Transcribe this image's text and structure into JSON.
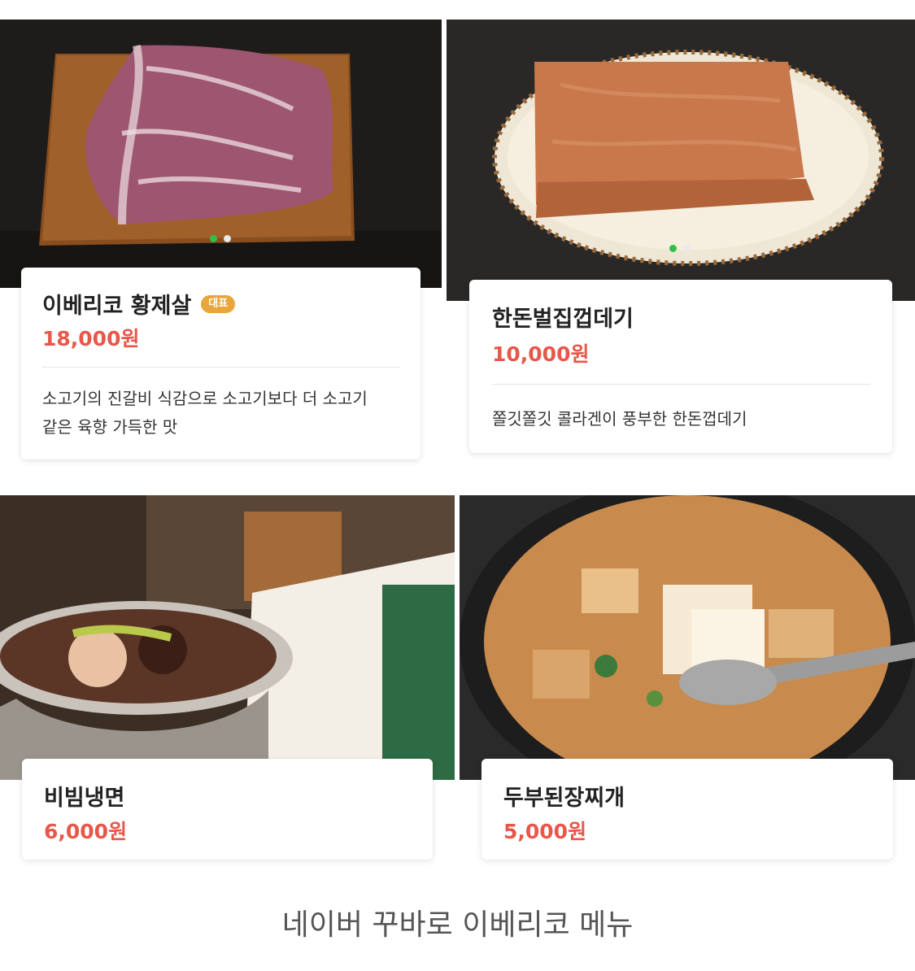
{
  "caption": "네이버 꾸바로 이베리코 메뉴",
  "colors": {
    "price": "#e8574a",
    "badge": "#e9a73b",
    "dot_active": "#2fbf4a",
    "dot_inactive": "#e9e9e9"
  },
  "menu": [
    {
      "name": "이베리코 황제살",
      "badge": "대표",
      "price": "18,000원",
      "desc_line1": "소고기의 진갈비 식감으로 소고기보다 더 소고기",
      "desc_line2": "같은 육향 가득한 맛",
      "photo": "iberico-steak-on-wooden-board"
    },
    {
      "name": "한돈벌집껍데기",
      "price": "10,000원",
      "desc_line1": "쫄깃쫄깃 콜라겐이 풍부한 한돈껍데기",
      "photo": "pork-skin-on-plate"
    },
    {
      "name": "비빔냉면",
      "price": "6,000원",
      "photo": "bibim-naengmyeon-bowl"
    },
    {
      "name": "두부된장찌개",
      "price": "5,000원",
      "photo": "tofu-doenjang-stew"
    }
  ]
}
